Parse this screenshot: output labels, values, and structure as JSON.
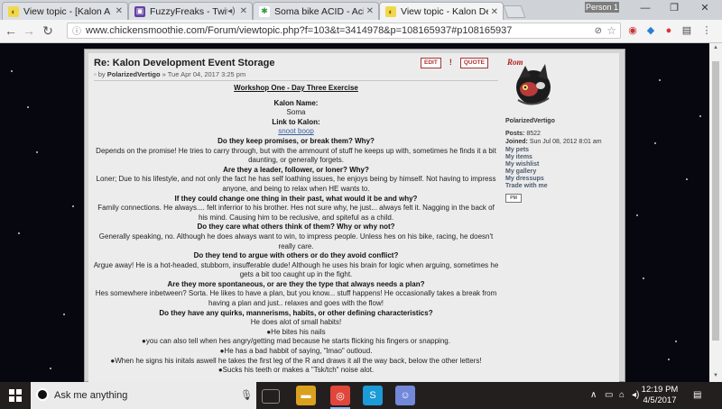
{
  "browser": {
    "tabs": [
      {
        "title": "View topic - [Kalon A",
        "active": false
      },
      {
        "title": "FuzzyFreaks - Twitch",
        "active": false
      },
      {
        "title": "Soma bike ACID - Acidin",
        "active": false
      },
      {
        "title": "View topic - Kalon Devel",
        "active": true
      }
    ],
    "profile": "Person 1",
    "url": "www.chickensmoothie.com/Forum/viewtopic.php?f=103&t=3414978&p=108165937#p108165937"
  },
  "post": {
    "title": "Re: Kalon Development Event Storage",
    "author": "PolarizedVertigo",
    "date": "Tue Apr 04, 2017 3:25 pm",
    "edit_label": "EDIT",
    "warn_label": "!",
    "quote_label": "QUOTE",
    "lines": [
      {
        "text": "Workshop One - Day Three Exercise",
        "style": "hu"
      },
      {
        "text": "",
        "style": "gap"
      },
      {
        "text": "Kalon Name:",
        "style": "h"
      },
      {
        "text": "Soma",
        "style": "n"
      },
      {
        "text": "Link to Kalon:",
        "style": "h"
      },
      {
        "text": "snoot boop",
        "style": "link"
      },
      {
        "text": "Do they keep promises, or break them? Why?",
        "style": "h"
      },
      {
        "text": "Depends on the promise! He tries to carry through, but with the ammount of stuff he keeps up with, sometimes he finds it a bit daunting, or generally forgets.",
        "style": "n"
      },
      {
        "text": "Are they a leader, follower, or loner? Why?",
        "style": "h"
      },
      {
        "text": "Loner; Due to his lifestyle, and not only the fact he has self loathing issues, he enjoys being by himself. Not having to impress anyone, and being to relax when HE wants to.",
        "style": "n"
      },
      {
        "text": "If they could change one thing in their past, what would it be and why?",
        "style": "h"
      },
      {
        "text": "Family connections. He always.... felt inferrior to his brother. Hes not sure why, he just... always felt it. Nagging in the back of his mind. Causing him to be reclusive, and spiteful as a child.",
        "style": "n"
      },
      {
        "text": "Do they care what others think of them? Why or why not?",
        "style": "h"
      },
      {
        "text": "Generally speaking, no. Although he does always want to win, to impress people. Unless hes on his bike, racing, he doesn't really care.",
        "style": "n"
      },
      {
        "text": "Do they tend to argue with others or do they avoid conflict?",
        "style": "h"
      },
      {
        "text": "Argue away! He is a hot-headed, stubborn, insufferable dude! Although he uses his brain for logic when arguing, sometimes he gets a bit too caught up in the fight.",
        "style": "n"
      },
      {
        "text": "Are they more spontaneous, or are they the type that always needs a plan?",
        "style": "h"
      },
      {
        "text": "Hes somewhere inbetween? Sorta. He likes to have a plan, but you know... stuff happens! He occasionally takes a break from having a plan and just.. relaxes and goes with the flow!",
        "style": "n"
      },
      {
        "text": "Do they have any quirks, mannerisms, habits, or other defining characteristics?",
        "style": "h"
      },
      {
        "text": "He does alot of small habits!",
        "style": "n"
      },
      {
        "text": "●He bites his nails",
        "style": "n"
      },
      {
        "text": "●you can also tell when hes angry/getting mad because he starts flicking his fingers or snapping.",
        "style": "n"
      },
      {
        "text": "●He has a bad habbit of saying, \"lmao\" outloud.",
        "style": "n"
      },
      {
        "text": "●When he signs his initals aswell he takes the first leg of the R and draws it all the way back, below the other letters!",
        "style": "n"
      },
      {
        "text": "●Sucks his teeth or makes a \"Tsk/tch\" noise alot.",
        "style": "n"
      }
    ]
  },
  "profile": {
    "username": "PolarizedVertigo",
    "posts_label": "Posts:",
    "posts_value": "8522",
    "joined_label": "Joined:",
    "joined_value": "Sun Jul 08, 2012 8:01 am",
    "links": [
      "My pets",
      "My items",
      "My wishlist",
      "My gallery",
      "My dressups",
      "Trade with me"
    ],
    "pm_label": "PM"
  },
  "taskbar": {
    "search_placeholder": "Ask me anything",
    "time": "12:19 PM",
    "date": "4/5/2017"
  },
  "colors": {
    "accent": "#3b5fa0",
    "taskbar": "#241f1f"
  }
}
